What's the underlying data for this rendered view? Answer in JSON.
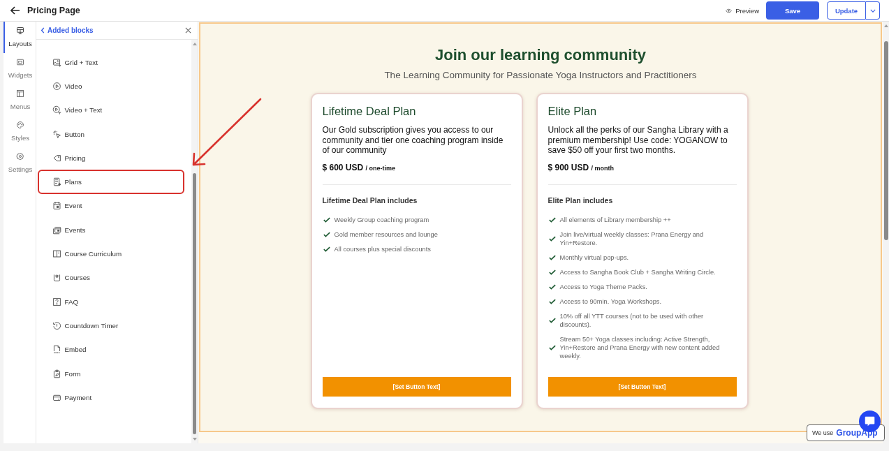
{
  "top_bar": {
    "title": "Pricing Page",
    "preview": "Preview",
    "save": "Save",
    "update": "Update"
  },
  "rail": {
    "tabs": [
      {
        "label": "Layouts",
        "selected": true
      },
      {
        "label": "Widgets",
        "selected": false
      },
      {
        "label": "Menus",
        "selected": false
      },
      {
        "label": "Styles",
        "selected": false
      },
      {
        "label": "Settings",
        "selected": false
      }
    ]
  },
  "panel": {
    "back_link": "Added blocks",
    "blocks": [
      {
        "label": "Grid + Text",
        "highlighted": false
      },
      {
        "label": "Video",
        "highlighted": false
      },
      {
        "label": "Video + Text",
        "highlighted": false
      },
      {
        "label": "Button",
        "highlighted": false
      },
      {
        "label": "Pricing",
        "highlighted": false
      },
      {
        "label": "Plans",
        "highlighted": true
      },
      {
        "label": "Event",
        "highlighted": false
      },
      {
        "label": "Events",
        "highlighted": false
      },
      {
        "label": "Course Curriculum",
        "highlighted": false
      },
      {
        "label": "Courses",
        "highlighted": false
      },
      {
        "label": "FAQ",
        "highlighted": false
      },
      {
        "label": "Countdown Timer",
        "highlighted": false
      },
      {
        "label": "Embed",
        "highlighted": false
      },
      {
        "label": "Form",
        "highlighted": false
      },
      {
        "label": "Payment",
        "highlighted": false
      }
    ]
  },
  "annotation": {
    "arrow": true
  },
  "page": {
    "heading": "Join our learning community",
    "subheading": "The Learning Community for Passionate Yoga Instructors and Practitioners",
    "plans": [
      {
        "title": "Lifetime Deal Plan",
        "description": "Our Gold subscription gives you access to our community and tier one coaching program inside of our community",
        "price": "$ 600 USD",
        "period": "/ one-time",
        "includes_title": "Lifetime Deal Plan includes",
        "features": [
          "Weekly Group coaching program",
          "Gold member resources and lounge",
          "All courses plus special discounts"
        ],
        "button": "[Set Button Text]"
      },
      {
        "title": "Elite Plan",
        "description": "Unlock all the perks of our Sangha Library with a premium membership! Use code: YOGANOW to save $50 off your first two months.",
        "price": "$ 900 USD",
        "period": "/ month",
        "includes_title": "Elite Plan includes",
        "features": [
          "All elements of Library membership ++",
          "Join live/virtual weekly classes: Prana Energy and Yin+Restore.",
          "Monthly virtual pop-ups.",
          "Access to Sangha Book Club + Sangha Writing Circle.",
          "Access to Yoga Theme Packs.",
          "Access to 90min. Yoga Workshops.",
          "10% off all YTT courses (not to be used with other discounts).",
          "Stream 50+ Yoga classes including: Active Strength, Yin+Restore and Prana Energy with new content added weekly."
        ],
        "button": "[Set Button Text]"
      }
    ]
  },
  "badge": {
    "text": "We use",
    "brand": "GroupApp"
  }
}
